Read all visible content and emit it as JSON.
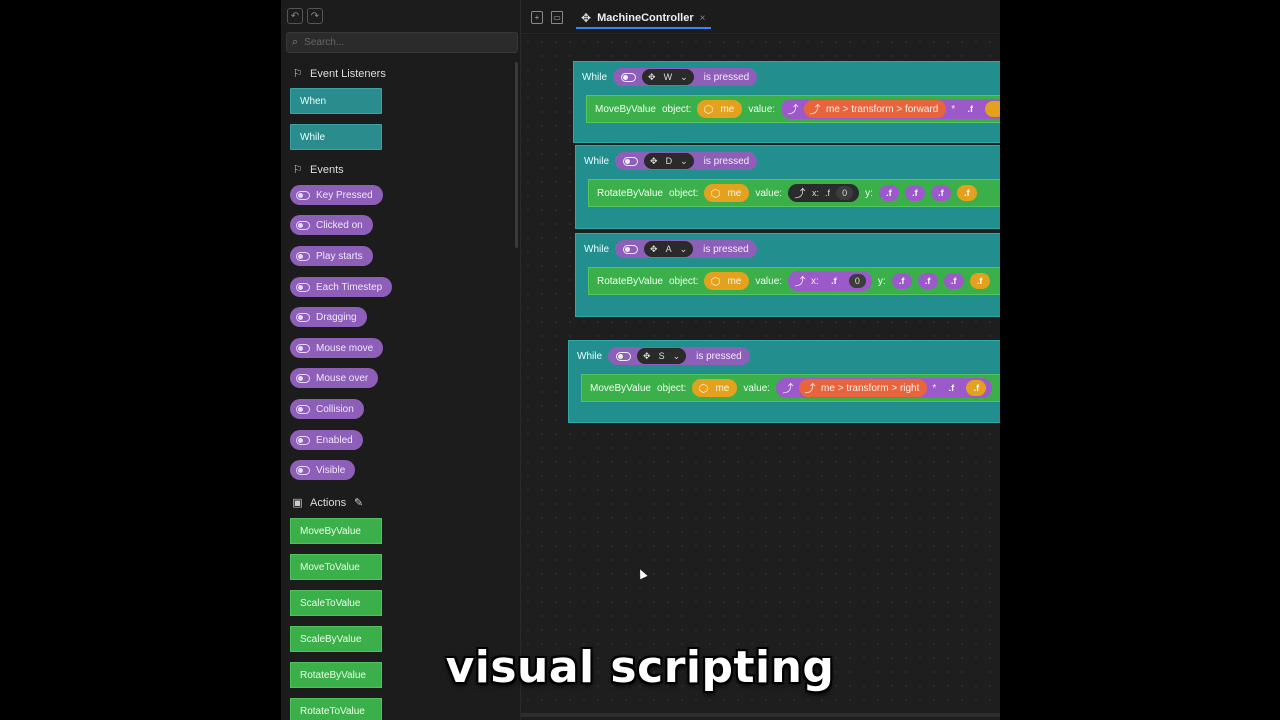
{
  "sidebar": {
    "search_placeholder": "Search...",
    "sections": {
      "event_listeners": {
        "title": "Event Listeners",
        "items": [
          "When",
          "While"
        ]
      },
      "events": {
        "title": "Events",
        "items": [
          "Key Pressed",
          "Clicked on",
          "Play starts",
          "Each Timestep",
          "Dragging",
          "Mouse move",
          "Mouse over",
          "Collision",
          "Enabled",
          "Visible"
        ]
      },
      "actions": {
        "title": "Actions",
        "items": [
          "MoveByValue",
          "MoveToValue",
          "ScaleToValue",
          "ScaleByValue",
          "RotateByValue",
          "RotateToValue"
        ]
      }
    }
  },
  "tab": {
    "name": "MachineController",
    "close": "×"
  },
  "canvas": {
    "blocks": [
      {
        "while": "While",
        "key": "W",
        "pressed": "is pressed",
        "action": "MoveByValue",
        "object_label": "object:",
        "object": "me",
        "value_label": "value:",
        "value": "me > transform > forward",
        "op": "*",
        "fn": ".f"
      },
      {
        "while": "While",
        "key": "D",
        "pressed": "is pressed",
        "action": "RotateByValue",
        "object_label": "object:",
        "object": "me",
        "value_label": "value:",
        "x_label": "x:",
        "fn": ".f",
        "x_value": "0",
        "y_label": "y:"
      },
      {
        "while": "While",
        "key": "A",
        "pressed": "is pressed",
        "action": "RotateByValue",
        "object_label": "object:",
        "object": "me",
        "value_label": "value:",
        "x_label": "x:",
        "fn": ".f",
        "x_value": "0",
        "y_label": "y:"
      },
      {
        "while": "While",
        "key": "S",
        "pressed": "is pressed",
        "action": "MoveByValue",
        "object_label": "object:",
        "object": "me",
        "value_label": "value:",
        "value": "me > transform > right",
        "op": "*",
        "fn": ".f"
      }
    ]
  },
  "caption": "visual scripting",
  "colors": {
    "teal": "#228e8e",
    "purple": "#8e5fb8",
    "green": "#3bb04a",
    "orange": "#e4a11d",
    "coral": "#e8643d",
    "accent": "#3b82f6"
  }
}
